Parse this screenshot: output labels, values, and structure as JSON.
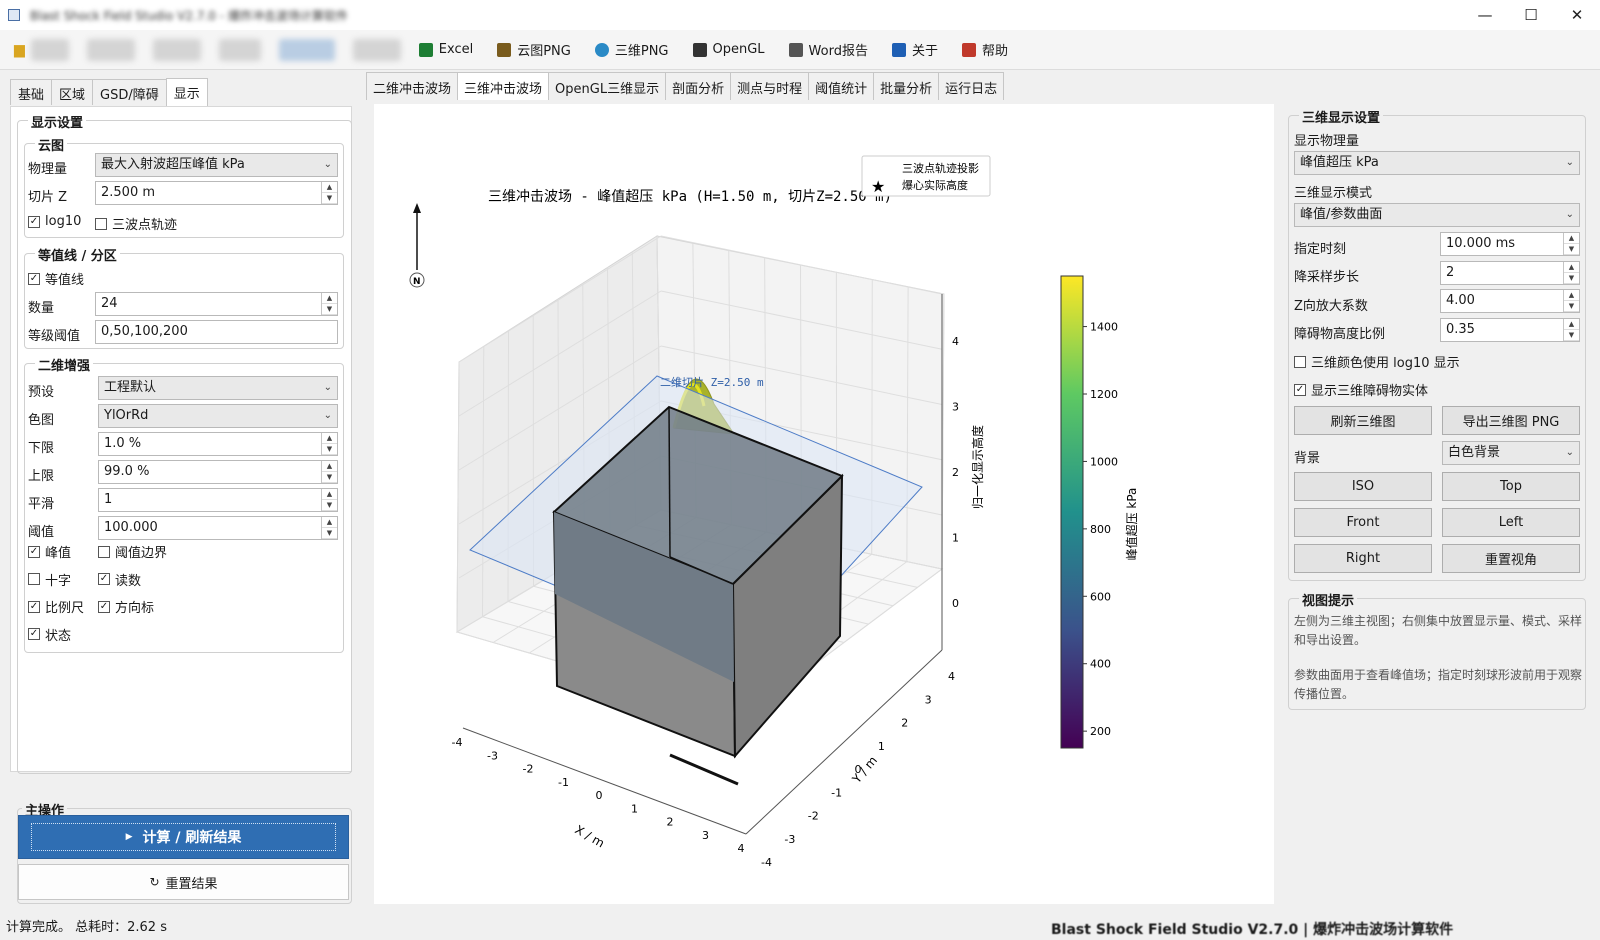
{
  "window": {
    "title": "Blast Shock Field Studio V2.7.0 - 爆炸冲击波场计算软件",
    "min": "—",
    "max": "☐",
    "close": "✕"
  },
  "toolbar": {
    "blurred_count": 6,
    "items": [
      {
        "label": "Excel",
        "icon": "excel-icon",
        "color": "#1e7e34"
      },
      {
        "label": "云图PNG",
        "icon": "image-icon",
        "color": "#7a5c1e"
      },
      {
        "label": "三维PNG",
        "icon": "globe-icon",
        "color": "#2a8ac6"
      },
      {
        "label": "OpenGL",
        "icon": "monitor-icon",
        "color": "#333333"
      },
      {
        "label": "Word报告",
        "icon": "document-icon",
        "color": "#555555"
      },
      {
        "label": "关于",
        "icon": "info-icon",
        "color": "#1e5fb4"
      },
      {
        "label": "帮助",
        "icon": "help-icon",
        "color": "#c0392b"
      }
    ]
  },
  "left": {
    "tabs": [
      "基础",
      "区域",
      "GSD/障碍",
      "显示"
    ],
    "active_tab": 3,
    "display_group": "显示设置",
    "cloud": {
      "title": "云图",
      "quantity_label": "物理量",
      "quantity_value": "最大入射波超压峰值 kPa",
      "slice_label": "切片 Z",
      "slice_value": "2.500 m",
      "log10": "log10",
      "log10_checked": true,
      "trajectory": "三波点轨迹",
      "trajectory_checked": false
    },
    "contour": {
      "title": "等值线 / 分区",
      "contour_label": "等值线",
      "contour_checked": true,
      "count_label": "数量",
      "count_value": "24",
      "threshold_label": "等级阈值",
      "threshold_value": "0,50,100,200"
    },
    "enhance": {
      "title": "二维增强",
      "preset_label": "预设",
      "preset_value": "工程默认",
      "cmap_label": "色图",
      "cmap_value": "YlOrRd",
      "lower_label": "下限",
      "lower_value": "1.0 %",
      "upper_label": "上限",
      "upper_value": "99.0 %",
      "smooth_label": "平滑",
      "smooth_value": "1",
      "thr_label": "阈值",
      "thr_value": "100.000",
      "checks": [
        {
          "label": "峰值",
          "checked": true
        },
        {
          "label": "阈值边界",
          "checked": false
        },
        {
          "label": "十字",
          "checked": false
        },
        {
          "label": "读数",
          "checked": true
        },
        {
          "label": "比例尺",
          "checked": true
        },
        {
          "label": "方向标",
          "checked": true
        },
        {
          "label": "状态",
          "checked": true
        }
      ]
    },
    "main_ops": {
      "title": "主操作",
      "compute": "计算 / 刷新结果",
      "reset": "重置结果"
    }
  },
  "center_tabs": [
    "二维冲击波场",
    "三维冲击波场",
    "OpenGL三维显示",
    "剖面分析",
    "测点与时程",
    "阈值统计",
    "批量分析",
    "运行日志"
  ],
  "center_active_tab": 1,
  "chart_data": {
    "type": "surface3d",
    "title": "三维冲击波场 - 峰值超压 kPa (H=1.50 m, 切片Z=2.50 m)",
    "xlabel": "X / m",
    "ylabel": "Y / m",
    "zlabel": "归一化显示高度",
    "x_ticks": [
      "-4",
      "-3",
      "-2",
      "-1",
      "0",
      "1",
      "2",
      "3",
      "4"
    ],
    "y_ticks": [
      "-4",
      "-3",
      "-2",
      "-1",
      "0",
      "1",
      "2",
      "3",
      "4"
    ],
    "z_ticks": [
      "0",
      "1",
      "2",
      "3",
      "4"
    ],
    "slice_label": "二维切片 Z=2.50 m",
    "north": "N",
    "legend": [
      {
        "label": "三波点轨迹投影",
        "marker": "line"
      },
      {
        "label": "爆心实际高度",
        "marker": "star",
        "color": "#d62728"
      }
    ],
    "colorbar": {
      "label": "峰值超压 kPa",
      "min": 150,
      "max": 1550,
      "ticks": [
        "200",
        "400",
        "600",
        "800",
        "1000",
        "1200",
        "1400"
      ],
      "cmap": "viridis"
    }
  },
  "right": {
    "group": "三维显示设置",
    "quantity_label": "显示物理量",
    "quantity_value": "峰值超压 kPa",
    "mode_label": "三维显示模式",
    "mode_value": "峰值/参数曲面",
    "time_label": "指定时刻",
    "time_value": "10.000 ms",
    "step_label": "降采样步长",
    "step_value": "2",
    "zscale_label": "Z向放大系数",
    "zscale_value": "4.00",
    "obs_label": "障碍物高度比例",
    "obs_value": "0.35",
    "log_color": "三维颜色使用 log10 显示",
    "log_color_checked": false,
    "show_obs": "显示三维障碍物实体",
    "show_obs_checked": true,
    "refresh": "刷新三维图",
    "export": "导出三维图 PNG",
    "bg_label": "背景",
    "bg_value": "白色背景",
    "views": [
      "ISO",
      "Top",
      "Front",
      "Left",
      "Right",
      "重置视角"
    ],
    "hint_title": "视图提示",
    "hint1": "左侧为三维主视图；右侧集中放置显示量、模式、采样和导出设置。",
    "hint2": "参数曲面用于查看峰值场；指定时刻球形波前用于观察传播位置。"
  },
  "status": {
    "left": "计算完成。 总耗时：2.62 s",
    "right": "Blast Shock Field Studio V2.7.0 | 爆炸冲击波场计算软件"
  }
}
